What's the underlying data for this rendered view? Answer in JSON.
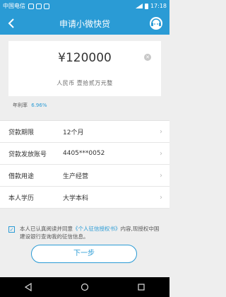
{
  "status": {
    "carrier": "中国电信",
    "time": "17:18"
  },
  "header": {
    "title": "申请小微快贷",
    "back_icon": "back-chevron-icon",
    "service_icon": "customer-service-icon"
  },
  "loan": {
    "amount": "¥120000",
    "amount_in_words": "人民币 壹拾贰万元整",
    "rate_label": "年利率",
    "rate_value": "6.96%"
  },
  "form": {
    "rows": [
      {
        "label": "贷款期限",
        "value": "12个月"
      },
      {
        "label": "贷款发放账号",
        "value": "4405***0052"
      },
      {
        "label": "借款用途",
        "value": "生产经营"
      },
      {
        "label": "本人学历",
        "value": "大学本科"
      }
    ]
  },
  "agreement": {
    "text_before": "本人已认真阅读并同意",
    "link": "《个人征信授权书》",
    "text_after": "内容,现授权中国建设银行查询我的征信信息。"
  },
  "actions": {
    "next_label": "下一步"
  },
  "colors": {
    "accent": "#2a9bd5",
    "background": "#eeeeee"
  }
}
